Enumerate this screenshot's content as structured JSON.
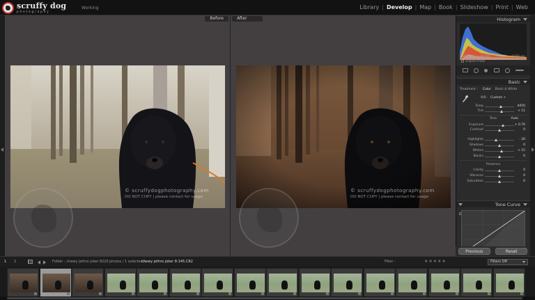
{
  "app": {
    "logo_title": "scruffy dog",
    "logo_subtitle": "photography",
    "status": "Working"
  },
  "modules": [
    {
      "label": "Library",
      "active": false
    },
    {
      "label": "Develop",
      "active": true
    },
    {
      "label": "Map",
      "active": false
    },
    {
      "label": "Book",
      "active": false
    },
    {
      "label": "Slideshow",
      "active": false
    },
    {
      "label": "Print",
      "active": false
    },
    {
      "label": "Web",
      "active": false
    }
  ],
  "compare": {
    "before_label": "Before",
    "after_label": "After"
  },
  "watermark": {
    "line1": "© scruffydogphotography.com",
    "line2": "DO NOT COPY | please contact for usage"
  },
  "histogram": {
    "title": "Histogram",
    "iso": "ISO 1000",
    "focal": "50 mm",
    "aperture": "f / 4.0",
    "shutter": "1/160 sec",
    "original_photo_label": "Original Photo"
  },
  "basic": {
    "title": "Basic",
    "treatment_label": "Treatment :",
    "treatment_color": "Color",
    "treatment_bw": "Black & White",
    "wb_label": "WB :",
    "wb_value": "Custom ÷",
    "sliders_wb": [
      {
        "label": "Temp",
        "value": "4450",
        "pos": 0.55
      },
      {
        "label": "Tint",
        "value": "+ 11",
        "pos": 0.58
      }
    ],
    "tone_label": "Tone",
    "auto_label": "Auto",
    "sliders_tone": [
      {
        "label": "Exposure",
        "value": "+ 0.70",
        "pos": 0.62
      },
      {
        "label": "Contrast",
        "value": "0",
        "pos": 0.5
      }
    ],
    "sliders_tone2": [
      {
        "label": "Highlights",
        "value": "- 30",
        "pos": 0.38
      },
      {
        "label": "Shadows",
        "value": "0",
        "pos": 0.5
      },
      {
        "label": "Whites",
        "value": "+ 15",
        "pos": 0.58
      },
      {
        "label": "Blacks",
        "value": "0",
        "pos": 0.5
      }
    ],
    "presence_label": "Presence",
    "sliders_presence": [
      {
        "label": "Clarity",
        "value": "0",
        "pos": 0.5
      },
      {
        "label": "Vibrance",
        "value": "0",
        "pos": 0.5
      },
      {
        "label": "Saturation",
        "value": "0",
        "pos": 0.5
      }
    ]
  },
  "tonecurve": {
    "title": "Tone Curve"
  },
  "buttons": {
    "previous": "Previous",
    "reset": "Reset"
  },
  "filmbar": {
    "page1": "1",
    "page2": "2",
    "path": "Folder : chewy jethro joker 8",
    "count": "220 photos / 1 selected /",
    "filename": "chewy jethro joker 8-145.CR2",
    "filter_label": "Filter :",
    "stars": "★★★★★",
    "filters_off": "Filters Off"
  },
  "filmstrip": [
    {
      "tone": "dark-warm",
      "selected": false
    },
    {
      "tone": "dark-warm",
      "selected": true
    },
    {
      "tone": "dark-warm",
      "selected": false
    },
    {
      "tone": "green",
      "selected": false
    },
    {
      "tone": "green",
      "selected": false
    },
    {
      "tone": "green",
      "selected": false
    },
    {
      "tone": "green",
      "selected": false
    },
    {
      "tone": "green",
      "selected": false
    },
    {
      "tone": "green",
      "selected": false
    },
    {
      "tone": "green",
      "selected": false
    },
    {
      "tone": "green",
      "selected": false
    },
    {
      "tone": "green",
      "selected": false
    },
    {
      "tone": "green",
      "selected": false
    },
    {
      "tone": "green",
      "selected": false
    },
    {
      "tone": "green",
      "selected": false
    },
    {
      "tone": "green",
      "selected": false
    }
  ],
  "colors": {
    "accent": "#f0f0f0",
    "logo_ring": "#cc3333"
  }
}
